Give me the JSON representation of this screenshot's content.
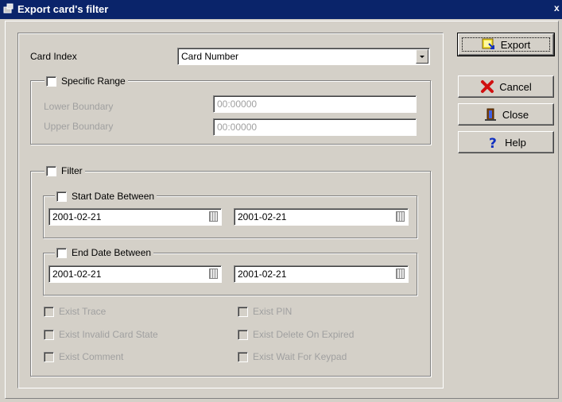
{
  "window": {
    "title": "Export card's filter",
    "close_glyph": "x"
  },
  "card_index": {
    "label": "Card Index",
    "selected": "Card Number"
  },
  "specific_range": {
    "label": "Specific Range",
    "lower_label": "Lower Boundary",
    "lower_value": "00:00000",
    "upper_label": "Upper Boundary",
    "upper_value": "00:00000"
  },
  "filter": {
    "label": "Filter",
    "start_date": {
      "label": "Start Date Between",
      "from": "2001-02-21",
      "to": "2001-02-21"
    },
    "end_date": {
      "label": "End Date Between",
      "from": "2001-02-21",
      "to": "2001-02-21"
    },
    "options": [
      "Exist Trace",
      "Exist PIN",
      "Exist Invalid Card State",
      "Exist Delete On Expired",
      "Exist Comment",
      "Exist Wait For Keypad"
    ]
  },
  "buttons": {
    "export": "Export",
    "cancel": "Cancel",
    "close": "Close",
    "help": "Help"
  },
  "icons": {
    "app": "app-icon",
    "export": "export-icon",
    "cancel": "cancel-x-icon",
    "close": "door-exit-icon",
    "help": "question-mark-icon",
    "calendar": "calendar-icon"
  },
  "colors": {
    "titlebar": "#0a246a",
    "face": "#d4d0c8",
    "disabled_text": "#a0a0a0",
    "cancel_red": "#d01010",
    "help_blue": "#1030c0"
  }
}
